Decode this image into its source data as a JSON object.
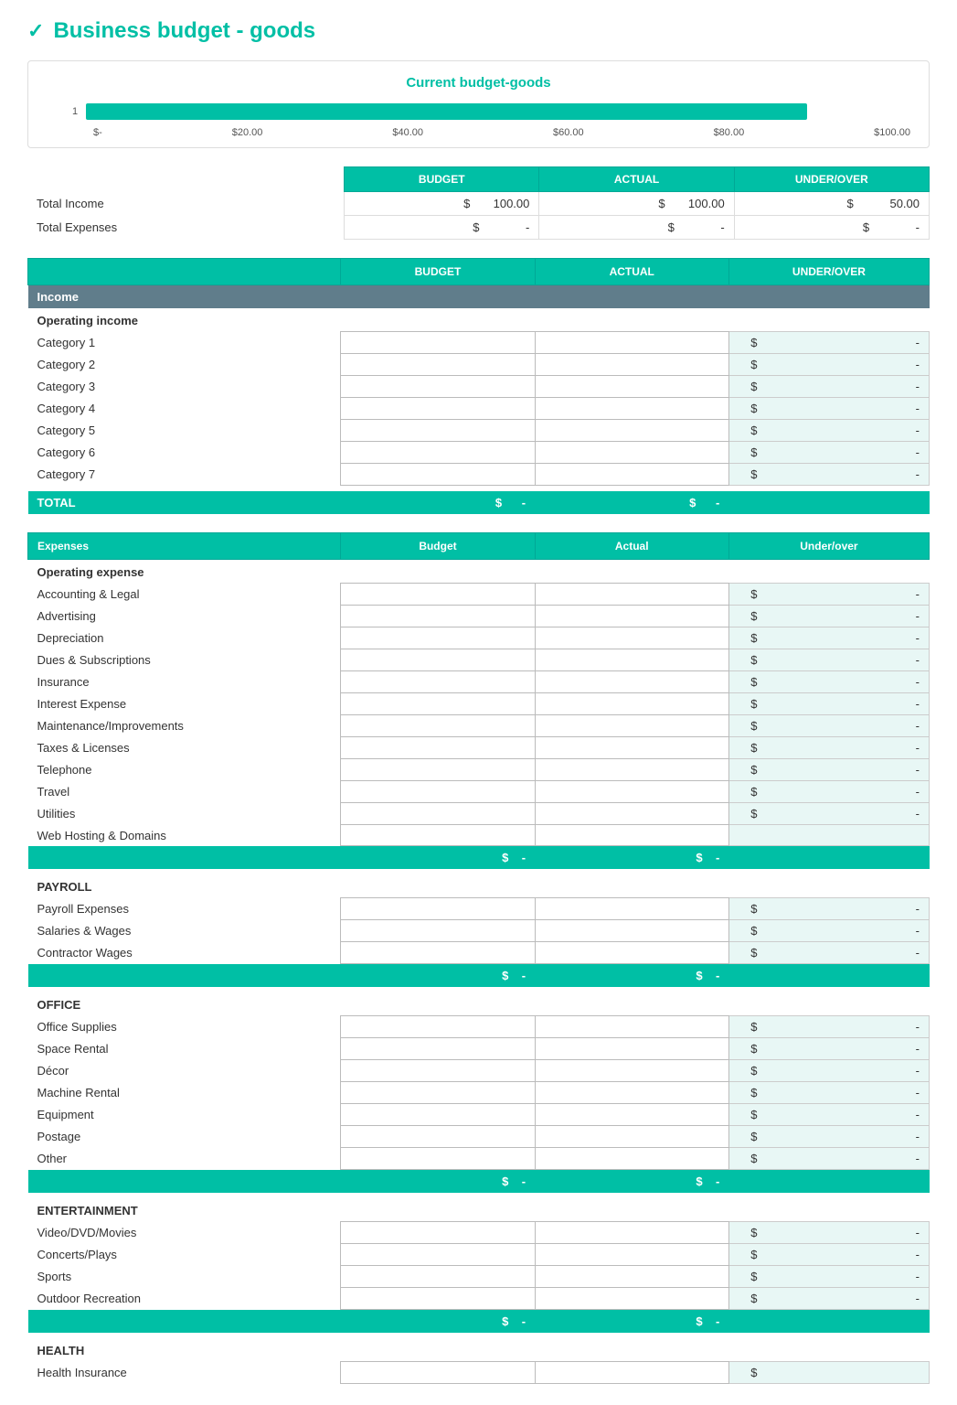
{
  "page": {
    "title": "Business budget - goods",
    "logo": "✓"
  },
  "chart": {
    "title": "Current budget-goods",
    "bar_label": "1",
    "bar_width_pct": 86,
    "x_labels": [
      "$-",
      "$20.00",
      "$40.00",
      "$60.00",
      "$80.00",
      "$100.00"
    ]
  },
  "summary": {
    "col1": "BUDGET",
    "col2": "ACTUAL",
    "col3": "UNDER/OVER",
    "rows": [
      {
        "label": "Total Income",
        "budget": "$ 100.00",
        "actual": "$ 100.00",
        "underover": "$ 50.00"
      },
      {
        "label": "Total Expenses",
        "budget": "$  -",
        "actual": "$  -",
        "underover": "$  -"
      }
    ]
  },
  "income_table": {
    "col_budget": "BUDGET",
    "col_actual": "ACTUAL",
    "col_underover": "UNDER/OVER",
    "income_section_label": "Income",
    "operating_income_label": "Operating income",
    "categories": [
      "Category 1",
      "Category 2",
      "Category 3",
      "Category 4",
      "Category 5",
      "Category 6",
      "Category 7"
    ],
    "total_label": "TOTAL",
    "total_budget": "$",
    "total_budget_val": "-",
    "total_actual": "$",
    "total_actual_val": "-"
  },
  "expenses_table": {
    "col_expenses": "Expenses",
    "col_budget": "Budget",
    "col_actual": "Actual",
    "col_underover": "Under/over",
    "operating_expense_label": "Operating expense",
    "operating_items": [
      "Accounting & Legal",
      "Advertising",
      "Depreciation",
      "Dues & Subscriptions",
      "Insurance",
      "Interest Expense",
      "Maintenance/Improvements",
      "Taxes & Licenses",
      "Telephone",
      "Travel",
      "Utilities",
      "Web Hosting & Domains"
    ],
    "payroll_label": "PAYROLL",
    "payroll_items": [
      "Payroll Expenses",
      "Salaries & Wages",
      "Contractor Wages"
    ],
    "office_label": "OFFICE",
    "office_items": [
      "Office Supplies",
      "Space Rental",
      "Décor",
      "Machine Rental",
      "Equipment",
      "Postage",
      "Other"
    ],
    "entertainment_label": "ENTERTAINMENT",
    "entertainment_items": [
      "Video/DVD/Movies",
      "Concerts/Plays",
      "Sports",
      "Outdoor Recreation"
    ],
    "health_label": "HEALTH",
    "health_items": [
      "Health Insurance"
    ]
  }
}
